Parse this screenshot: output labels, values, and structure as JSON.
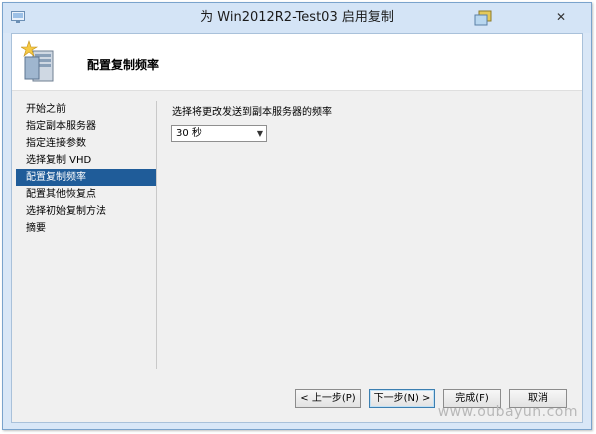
{
  "window": {
    "title": "为 Win2012R2-Test03 启用复制",
    "close_label": "✕"
  },
  "header": {
    "title": "配置复制频率"
  },
  "nav": {
    "items": [
      "开始之前",
      "指定副本服务器",
      "指定连接参数",
      "选择复制 VHD",
      "配置复制频率",
      "配置其他恢复点",
      "选择初始复制方法",
      "摘要"
    ],
    "selected_index": 4
  },
  "main": {
    "frequency_label": "选择将更改发送到副本服务器的频率",
    "frequency_value": "30 秒"
  },
  "buttons": {
    "prev": "< 上一步(P)",
    "next": "下一步(N) >",
    "finish": "完成(F)",
    "cancel": "取消"
  },
  "watermark": "www.oubayun.com",
  "colors": {
    "selected_bg": "#1f5c99",
    "titlebar": "#d4e4f6"
  }
}
